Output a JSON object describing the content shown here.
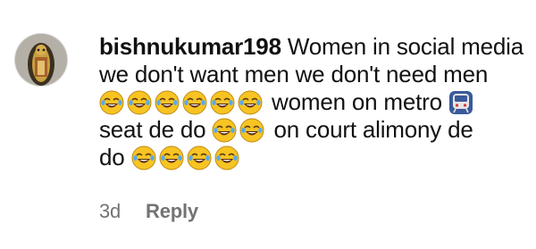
{
  "comment": {
    "username": "bishnukumar198",
    "line1_text": "Women in social media",
    "line2_text": "we don't want men we don't need men",
    "line3_text": "women on metro",
    "line4a_text": "seat de do",
    "line4b_text": "on court alimony de",
    "line5_text": "do",
    "emoji_icon": "face-with-tears-of-joy-icon",
    "metro_icon": "metro-train-icon",
    "timestamp": "3d",
    "reply_label": "Reply"
  }
}
